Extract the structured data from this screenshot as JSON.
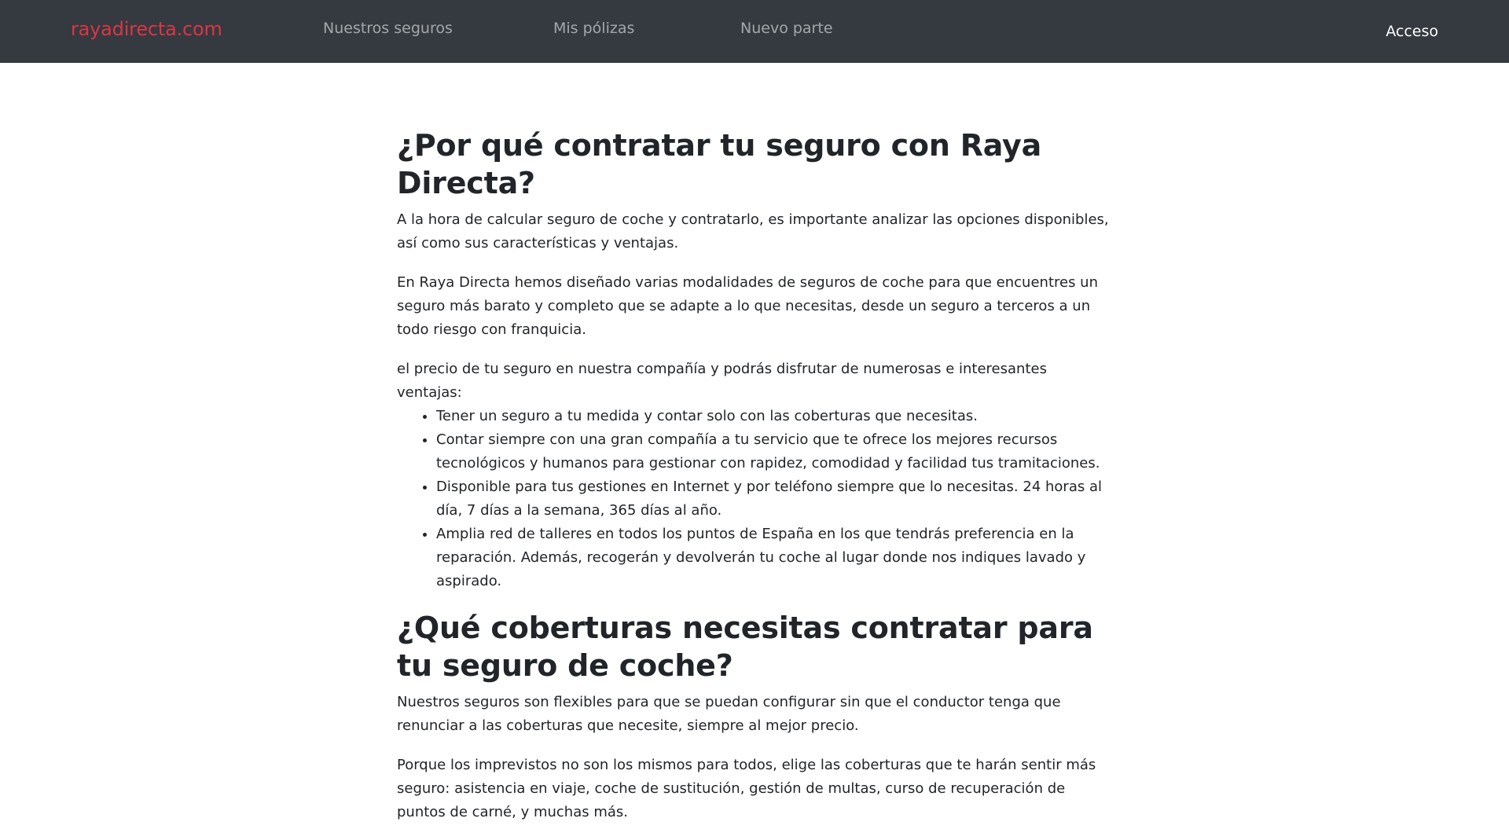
{
  "navbar": {
    "brand": "rayadirecta.com",
    "links": [
      {
        "label": "Nuestros seguros"
      },
      {
        "label": "Mis pólizas"
      },
      {
        "label": "Nuevo parte"
      }
    ],
    "login": "Acceso"
  },
  "section1": {
    "title": "¿Por qué contratar tu seguro con Raya Directa?",
    "paragraphs": [
      "A la hora de calcular seguro de coche y contratarlo, es importante analizar las opciones disponibles, así como sus características y ventajas.",
      "En Raya Directa hemos diseñado varias modalidades de seguros de coche para que encuentres un seguro más barato y completo que se adapte a lo que necesitas, desde un seguro a terceros a un todo riesgo con franquicia.",
      "el precio de tu seguro en nuestra compañía y podrás disfrutar de numerosas e interesantes ventajas:"
    ],
    "benefits": [
      "Tener un seguro a tu medida y contar solo con las coberturas que necesitas.",
      "Contar siempre con una gran compañía a tu servicio que te ofrece los mejores recursos tecnológicos y humanos para gestionar con rapidez, comodidad y facilidad tus tramitaciones.",
      "Disponible para tus gestiones en Internet y por teléfono siempre que lo necesitas. 24 horas al día, 7 días a la semana, 365 días al año.",
      "Amplia red de talleres en todos los puntos de España en los que tendrás preferencia en la reparación. Además, recogerán y devolverán tu coche al lugar donde nos indiques lavado y aspirado."
    ]
  },
  "section2": {
    "title": "¿Qué coberturas necesitas contratar para tu seguro de coche?",
    "paragraphs": [
      "Nuestros seguros son flexibles para que se puedan configurar sin que el conductor tenga que renunciar a las coberturas que necesite, siempre al mejor precio.",
      "Porque los imprevistos no son los mismos para todos, elige las coberturas que te harán sentir más seguro: asistencia en viaje, coche de sustitución, gestión de multas, curso de recuperación de puntos de carné, y muchas más."
    ]
  }
}
